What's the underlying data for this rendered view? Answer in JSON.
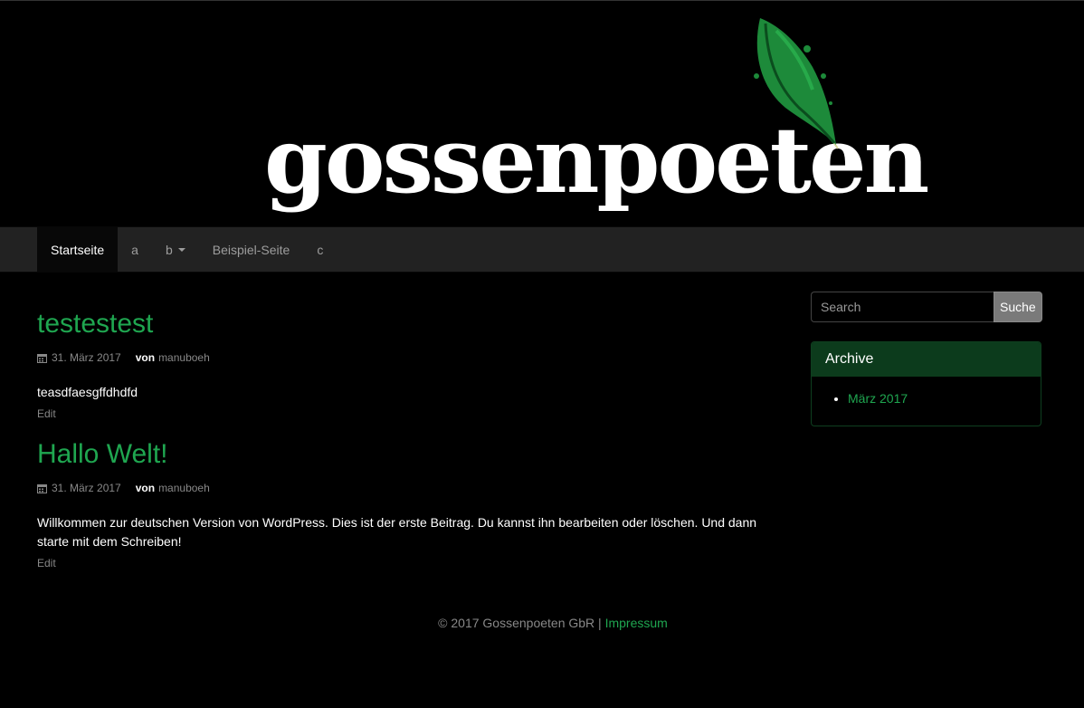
{
  "site": {
    "logo_text": "gossenpoeten",
    "logo_icon": "feather-quill-icon"
  },
  "nav": {
    "items": [
      {
        "label": "Startseite",
        "active": true
      },
      {
        "label": "a"
      },
      {
        "label": "b",
        "has_dropdown": true
      },
      {
        "label": "Beispiel-Seite"
      },
      {
        "label": "c"
      }
    ]
  },
  "posts": [
    {
      "title": "testestest",
      "date": "31. März 2017",
      "by_label": "von",
      "author": "manuboeh",
      "body": "teasdfaesgffdhdfd",
      "edit_label": "Edit"
    },
    {
      "title": "Hallo Welt!",
      "date": "31. März 2017",
      "by_label": "von",
      "author": "manuboeh",
      "body": "Willkommen zur deutschen Version von WordPress. Dies ist der erste Beitrag. Du kannst ihn bearbeiten oder löschen. Und dann starte mit dem Schreiben!",
      "edit_label": "Edit"
    }
  ],
  "sidebar": {
    "search": {
      "placeholder": "Search",
      "button_label": "Suche"
    },
    "archive": {
      "title": "Archive",
      "items": [
        "März 2017"
      ]
    }
  },
  "footer": {
    "copyright": "© 2017 Gossenpoeten GbR | ",
    "link_label": "Impressum"
  },
  "colors": {
    "accent": "#1fa650",
    "widget_header": "#0c3b1c",
    "navbar": "#222222"
  }
}
